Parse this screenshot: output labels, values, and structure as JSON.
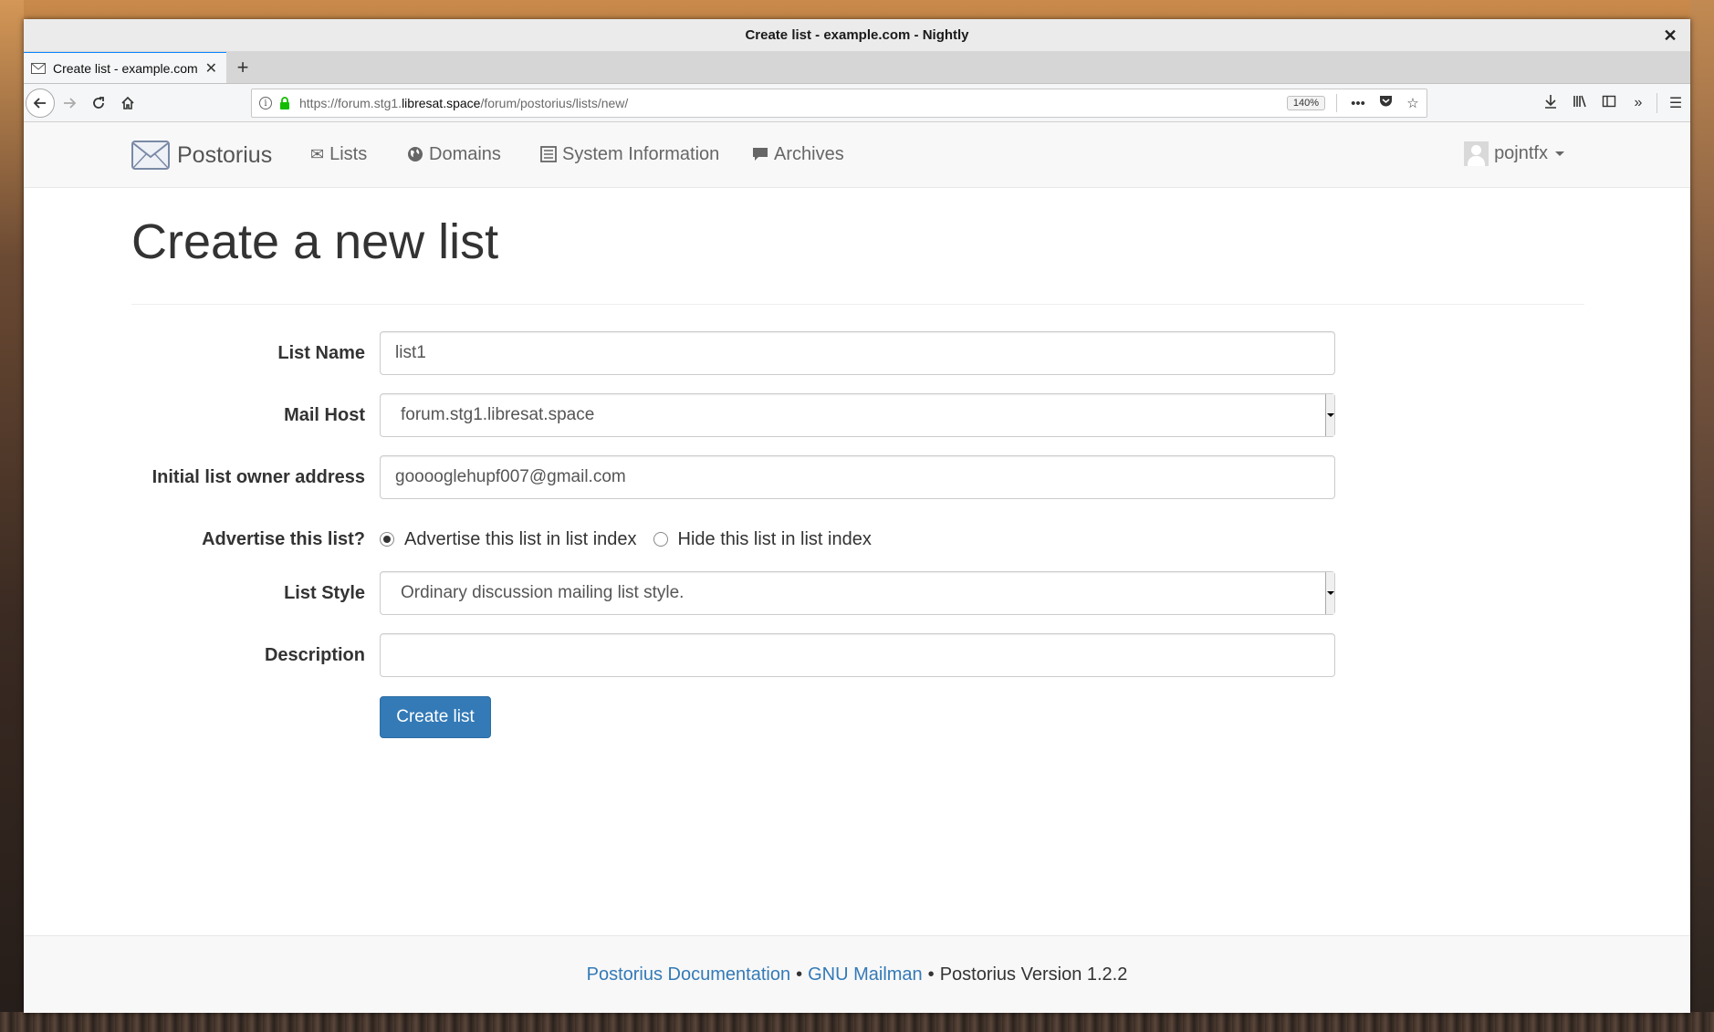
{
  "window": {
    "title": "Create list - example.com - Nightly",
    "close_label": "✕"
  },
  "browser": {
    "tab_title": "Create list - example.com",
    "tab_close": "✕",
    "new_tab": "+",
    "url_prefix": "https://forum.stg1.",
    "url_domain": "libresat.space",
    "url_path": "/forum/postorius/lists/new/",
    "zoom": "140%"
  },
  "site": {
    "brand": "Postorius",
    "nav": {
      "lists": "Lists",
      "domains": "Domains",
      "system_information": "System Information",
      "archives": "Archives"
    },
    "user": "pojntfx"
  },
  "form": {
    "heading": "Create a new list",
    "list_name_label": "List Name",
    "list_name_value": "list1",
    "mail_host_label": "Mail Host",
    "mail_host_value": "forum.stg1.libresat.space",
    "owner_label": "Initial list owner address",
    "owner_value": "gooooglehupf007@gmail.com",
    "advertise_label": "Advertise this list?",
    "advertise_option": "Advertise this list in list index",
    "hide_option": "Hide this list in list index",
    "advertise_selected": "advertise",
    "list_style_label": "List Style",
    "list_style_value": "Ordinary discussion mailing list style.",
    "description_label": "Description",
    "description_value": "",
    "submit_label": "Create list"
  },
  "footer": {
    "docs_link": "Postorius Documentation",
    "separator": "•",
    "mailman_link": "GNU Mailman",
    "version": "Postorius Version 1.2.2"
  },
  "colors": {
    "primary": "#337ab7",
    "tab_accent": "#0a84ff",
    "lock_green": "#12bc00"
  }
}
